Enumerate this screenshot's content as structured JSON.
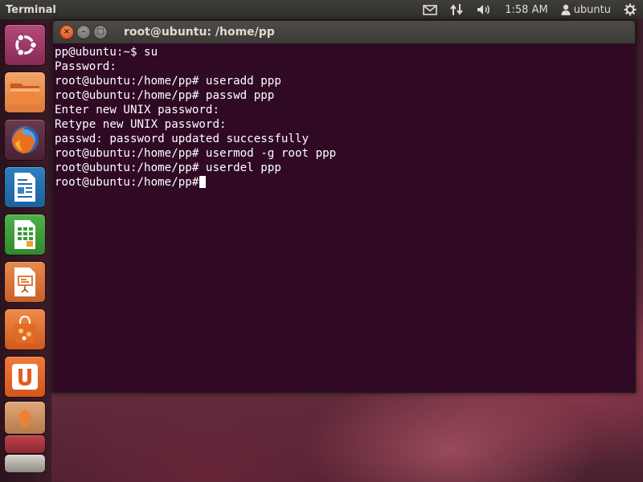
{
  "panel": {
    "title": "Terminal",
    "time": "1:58 AM",
    "user": "ubuntu",
    "icons": [
      "mail-icon",
      "network-icon",
      "volume-icon",
      "user-icon",
      "power-gear-icon"
    ]
  },
  "launcher": {
    "items": [
      {
        "name": "dash-home",
        "icon": "ubuntu-logo-icon"
      },
      {
        "name": "files",
        "icon": "folder-icon"
      },
      {
        "name": "firefox",
        "icon": "firefox-icon"
      },
      {
        "name": "writer",
        "icon": "document-icon"
      },
      {
        "name": "calc",
        "icon": "spreadsheet-icon"
      },
      {
        "name": "impress",
        "icon": "presentation-icon"
      },
      {
        "name": "software-center",
        "icon": "shopping-bag-icon"
      },
      {
        "name": "ubuntu-one",
        "icon": "ubuntu-one-icon"
      },
      {
        "name": "update-manager",
        "icon": "update-icon"
      },
      {
        "name": "workspaces",
        "icon": "workspace-icon"
      },
      {
        "name": "trash",
        "icon": "trash-icon"
      }
    ]
  },
  "window": {
    "title": "root@ubuntu: /home/pp",
    "buttons": {
      "close": "×",
      "minimize": "–",
      "maximize": "□"
    }
  },
  "terminal": {
    "lines": [
      "pp@ubuntu:~$ su",
      "Password:",
      "root@ubuntu:/home/pp# useradd ppp",
      "root@ubuntu:/home/pp# passwd ppp",
      "Enter new UNIX password:",
      "Retype new UNIX password:",
      "passwd: password updated successfully",
      "root@ubuntu:/home/pp# usermod -g root ppp",
      "root@ubuntu:/home/pp# userdel ppp",
      "root@ubuntu:/home/pp#"
    ]
  },
  "colors": {
    "terminal_bg": "#300a24",
    "terminal_fg": "#ffffff",
    "close_button": "#e8591e",
    "panel_bg": "#3a3935"
  }
}
